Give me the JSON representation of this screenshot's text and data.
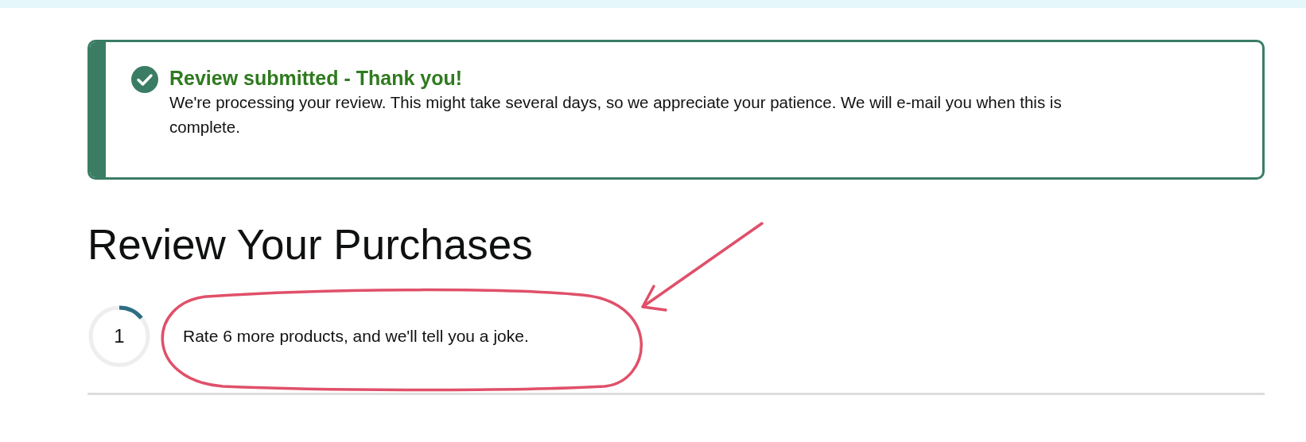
{
  "alert": {
    "title": "Review submitted - Thank you!",
    "message": "We're processing your review. This might take several days, so we appreciate your patience. We will e-mail you when this is complete."
  },
  "heading": "Review Your Purchases",
  "progress": {
    "count": "1",
    "message": "Rate 6 more products, and we'll tell you a joke."
  }
}
